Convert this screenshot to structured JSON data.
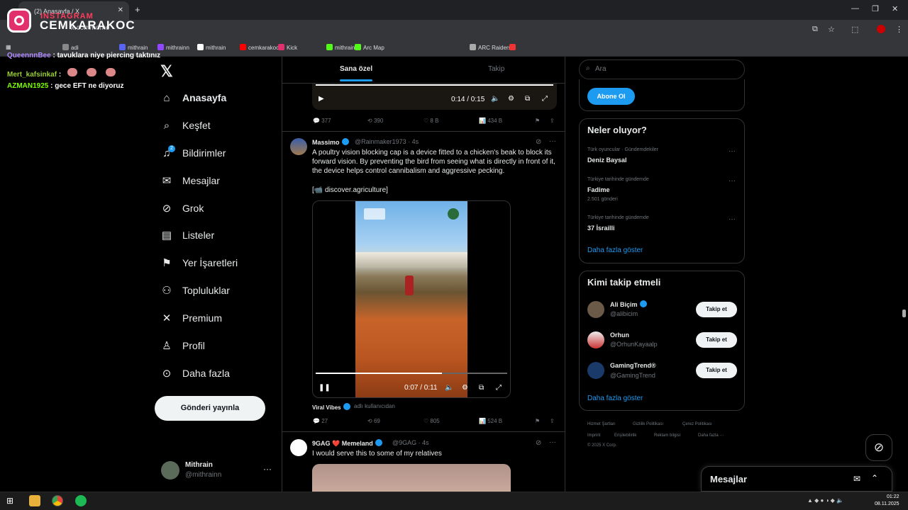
{
  "browser": {
    "tab_title": "(2) Anasayfa / X",
    "url": "x.com/home",
    "bookmarks": [
      "adi",
      "mithrain",
      "mithrainn",
      "mithrain",
      "cemkarakoc",
      "Kick",
      "mithrain",
      "Arc Map",
      "ARC Raiders"
    ]
  },
  "overlay": {
    "ig_label": "INSTAGRAM",
    "ig_name": "CEMKARAKOC",
    "chat": [
      {
        "user": "QueennnBee",
        "text": ": tavuklara niye piercing taktınız",
        "color": "#b18cff"
      },
      {
        "user": "Mert_kafsinkaf",
        "text": ":",
        "color": "#9acd32"
      },
      {
        "user": "AZMAN1925",
        "text": ": gece EFT ne diyoruz",
        "color": "#7cfc00"
      }
    ]
  },
  "nav": {
    "items": [
      {
        "label": "Anasayfa",
        "icon": "home-icon"
      },
      {
        "label": "Keşfet",
        "icon": "search-icon"
      },
      {
        "label": "Bildirimler",
        "icon": "bell-icon"
      },
      {
        "label": "Mesajlar",
        "icon": "mail-icon"
      },
      {
        "label": "Grok",
        "icon": "grok-icon"
      },
      {
        "label": "Listeler",
        "icon": "list-icon"
      },
      {
        "label": "Yer İşaretleri",
        "icon": "bookmark-icon"
      },
      {
        "label": "Topluluklar",
        "icon": "communities-icon"
      },
      {
        "label": "Premium",
        "icon": "x-icon"
      },
      {
        "label": "Profil",
        "icon": "person-icon"
      },
      {
        "label": "Daha fazla",
        "icon": "more-icon"
      }
    ],
    "notif_count": "2",
    "post_button": "Gönderi yayınla",
    "me": {
      "name": "Mithrain",
      "handle": "@mithrainn"
    }
  },
  "feed": {
    "tabs": [
      "Sana özel",
      "Takip"
    ],
    "video1": {
      "time": "0:14 / 0:15"
    },
    "post1_stats": {
      "replies": "377",
      "reposts": "390",
      "likes": "8 B",
      "views": "434 B"
    },
    "post2": {
      "name": "Massimo",
      "handle": "@Rainmaker1973 · 4s",
      "text": "A poultry vision blocking cap is a device fitted to a chicken's beak to block its forward vision. By preventing the bird from seeing what is directly in front of it, the device helps control cannibalism and aggressive pecking.",
      "source": "[📹 discover.agriculture]",
      "video_time": "0:07 / 0:11",
      "credit_name": "Viral Vibes",
      "credit_handle": "adlı kullanıcıdan",
      "replies": "27",
      "reposts": "69",
      "likes": "805",
      "views": "524 B"
    },
    "post3": {
      "name": "9GAG ❤️ Memeland",
      "handle": "@9GAG · 4s",
      "text": "I would serve this to some of my relatives"
    }
  },
  "sidebar": {
    "search_placeholder": "Ara",
    "subscribe": "Abone Ol",
    "trends_title": "Neler oluyor?",
    "trends": [
      {
        "meta": "Türk oyuncular · Gündemdekiler",
        "name": "Deniz Baysal",
        "count": ""
      },
      {
        "meta": "Türkiye tarihinde gündemde",
        "name": "Fadime",
        "count": "2.501 gönderi"
      },
      {
        "meta": "Türkiye tarihinde gündemde",
        "name": "37 İsrailli",
        "count": ""
      }
    ],
    "show_more": "Daha fazla göster",
    "who_title": "Kimi takip etmeli",
    "who": [
      {
        "name": "Ali Biçim",
        "handle": "@alibicim",
        "verified": true
      },
      {
        "name": "Orhun",
        "handle": "@OrhunKayaalp",
        "verified": false
      },
      {
        "name": "GamingTrend®",
        "handle": "@GamingTrend",
        "verified": false
      }
    ],
    "follow_label": "Takip et",
    "footer": [
      "Hizmet Şartları",
      "Gizlilik Politikası",
      "Çerez Politikası",
      "Imprint",
      "Erişilebilirlik",
      "Reklam bilgisi",
      "Daha fazla ···",
      "© 2025 X Corp."
    ],
    "messages": "Mesajlar"
  },
  "taskbar": {
    "time": "01:22",
    "date": "08.11.2025"
  }
}
